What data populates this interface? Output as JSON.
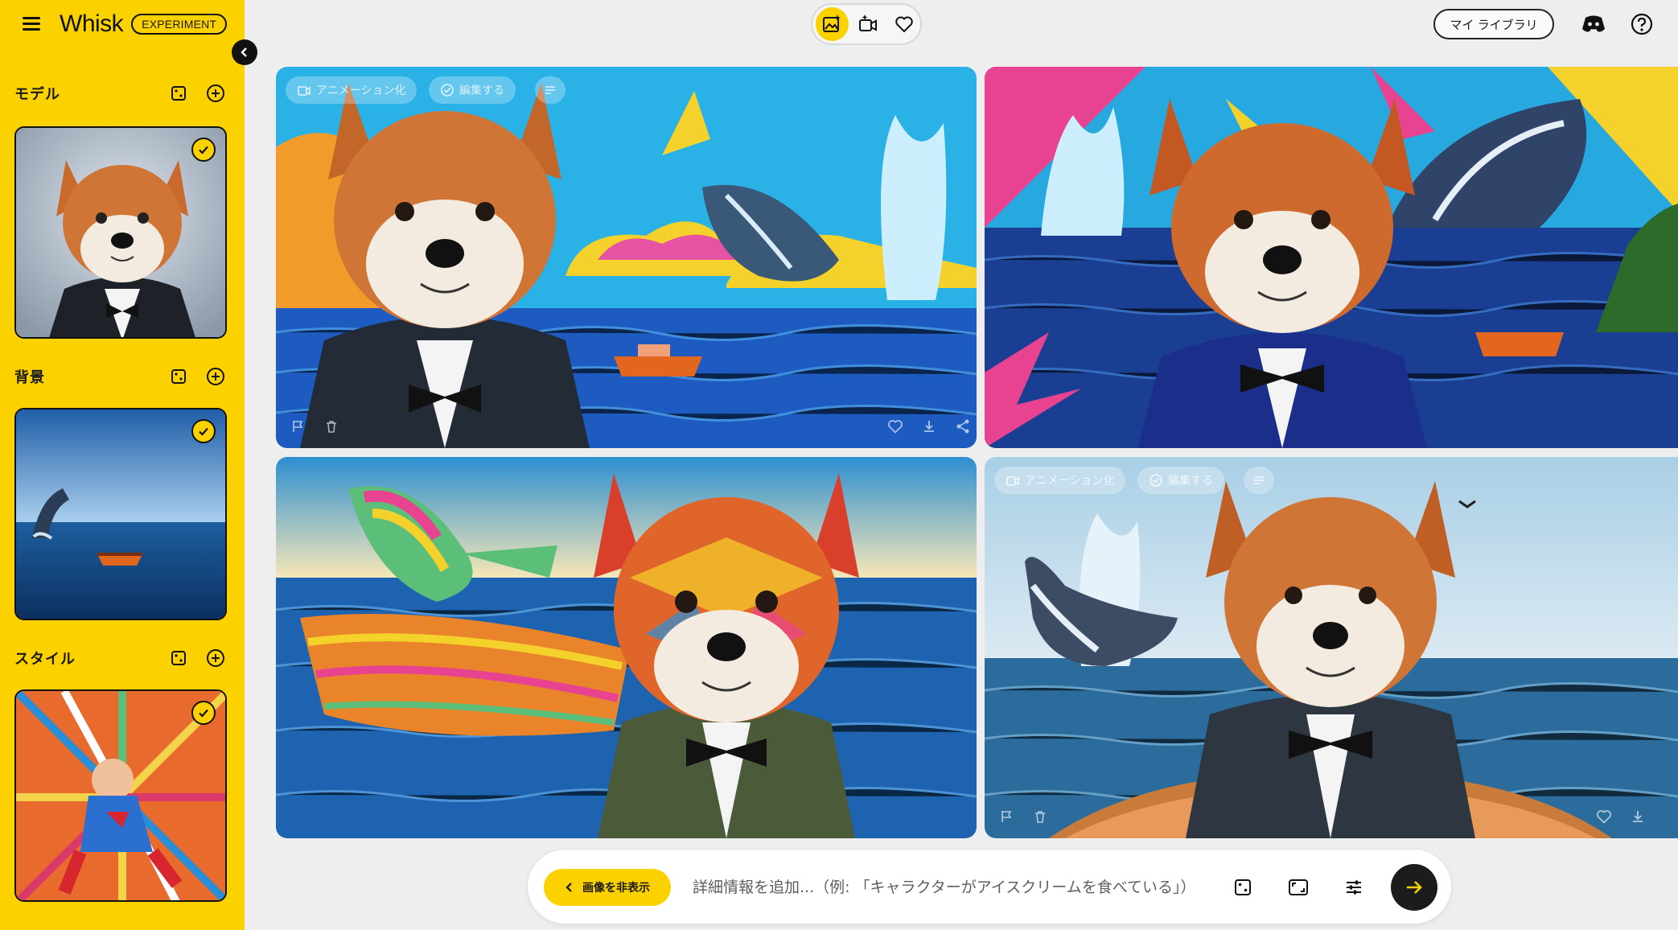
{
  "app": {
    "name": "Whisk",
    "badge": "EXPERIMENT"
  },
  "sidebar": {
    "sections": [
      {
        "title": "モデル",
        "thumb": "shiba-inu-in-tuxedo",
        "selected": true
      },
      {
        "title": "背景",
        "thumb": "whale-and-boat-on-ocean",
        "selected": true
      },
      {
        "title": "スタイル",
        "thumb": "comic-superhero",
        "selected": true
      }
    ]
  },
  "topbar": {
    "modes": [
      "image-mode",
      "video-mode",
      "favorites"
    ],
    "active_mode": "image-mode",
    "library_label": "マイ ライブラリ"
  },
  "gallery": {
    "overlay_animate": "アニメーション化",
    "overlay_edit": "編集する",
    "images": [
      {
        "id": "result-1",
        "style": "pop-art shiba with whale, blue sky"
      },
      {
        "id": "result-2",
        "style": "pop-art shiba with whale, lightning"
      },
      {
        "id": "result-3",
        "style": "colorful mosaic shiba with boat"
      },
      {
        "id": "result-4",
        "style": "shiba in rowboat with whale"
      }
    ]
  },
  "prompt": {
    "hide_images_label": "画像を非表示",
    "placeholder": "詳細情報を追加...（例: 「キャラクターがアイスクリームを食べている」）"
  },
  "colors": {
    "accent": "#fbd200",
    "dark": "#1c1c1c"
  }
}
